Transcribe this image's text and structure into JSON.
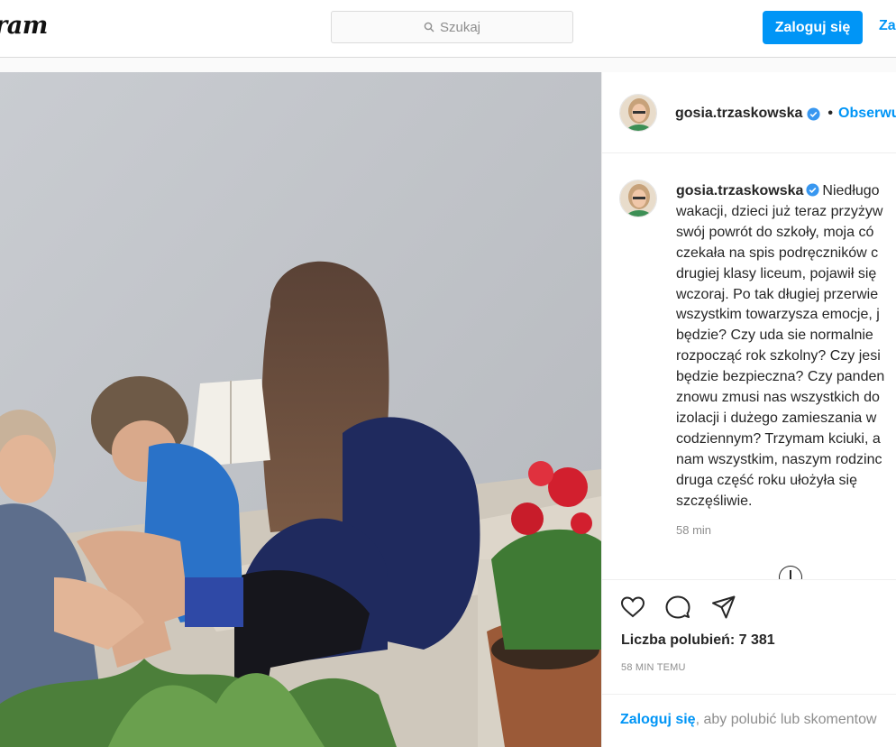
{
  "header": {
    "logo_text": "ram",
    "search_placeholder": "Szukaj",
    "login_button": "Zaloguj się",
    "register_link": "Za"
  },
  "post": {
    "username": "gosia.trzaskowska",
    "follow_label": "Obserwu",
    "caption_lines": [
      "Niedługo",
      "wakacji, dzieci już teraz przyżyw",
      "swój powrót do szkoły, moja có",
      "czekała na spis podręczników c",
      "drugiej klasy liceum, pojawił się",
      "wczoraj. Po tak długiej przerwie",
      "wszystkim towarzysza emocje, j",
      "będzie? Czy uda sie normalnie",
      "rozpocząć rok szkolny? Czy jesi",
      "będzie bezpieczna? Czy panden",
      "znowu zmusi nas wszystkich do",
      "izolacji i dużego zamieszania w",
      "codziennym? Trzymam kciuki, a",
      "nam wszystkim, naszym rodzinc",
      "druga część roku ułożyła się",
      "szczęśliwie."
    ],
    "caption_time": "58 min",
    "likes_text": "Liczba polubień: 7 381",
    "time_ago": "58 MIN TEMU",
    "login_prompt_link": "Zaloguj się",
    "login_prompt_rest": ", aby polubić lub skomentow"
  },
  "icons": [
    "search-icon",
    "verified-icon",
    "heart-icon",
    "comment-icon",
    "share-icon"
  ],
  "colors": {
    "accent": "#0095f6",
    "verified": "#3897f0",
    "muted": "#8e8e8e"
  }
}
